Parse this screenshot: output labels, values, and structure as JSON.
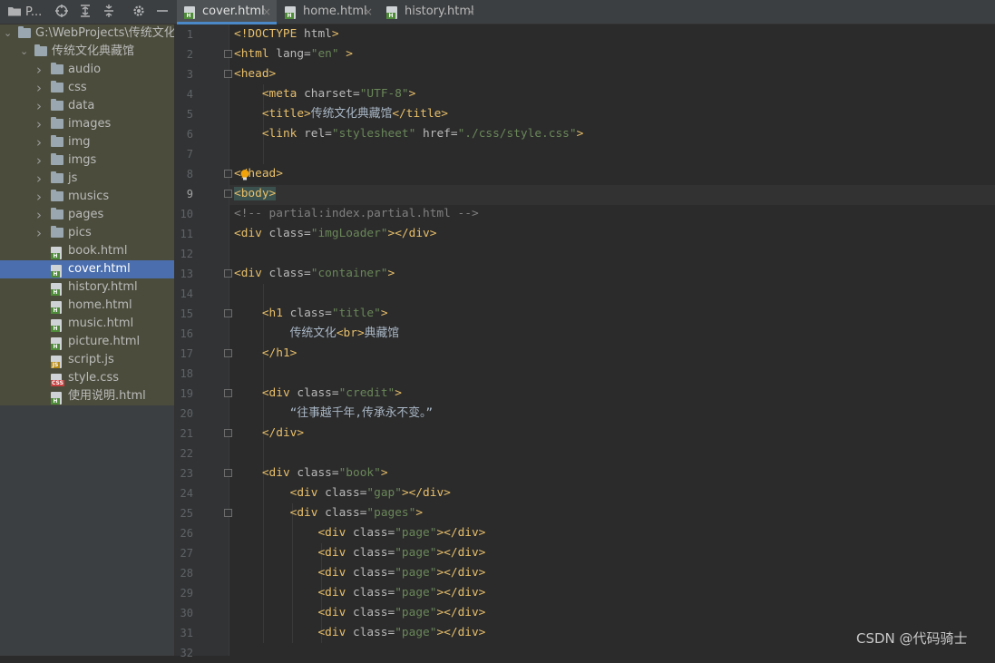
{
  "project_panel": {
    "title": "P...",
    "toolbar_icons": [
      "folder-icon",
      "locate-icon",
      "expand-all-icon",
      "collapse-all-icon",
      "gear-icon",
      "minimize-icon"
    ]
  },
  "tree": [
    {
      "label": "G:\\WebProjects\\传统文化典",
      "kind": "folder",
      "depth": 0,
      "expanded": true
    },
    {
      "label": "传统文化典藏馆",
      "kind": "folder",
      "depth": 1,
      "expanded": true
    },
    {
      "label": "audio",
      "kind": "folder",
      "depth": 2
    },
    {
      "label": "css",
      "kind": "folder",
      "depth": 2
    },
    {
      "label": "data",
      "kind": "folder",
      "depth": 2
    },
    {
      "label": "images",
      "kind": "folder",
      "depth": 2
    },
    {
      "label": "img",
      "kind": "folder",
      "depth": 2
    },
    {
      "label": "imgs",
      "kind": "folder",
      "depth": 2
    },
    {
      "label": "js",
      "kind": "folder",
      "depth": 2
    },
    {
      "label": "musics",
      "kind": "folder",
      "depth": 2
    },
    {
      "label": "pages",
      "kind": "folder",
      "depth": 2
    },
    {
      "label": "pics",
      "kind": "folder",
      "depth": 2
    },
    {
      "label": "book.html",
      "kind": "html",
      "depth": 2
    },
    {
      "label": "cover.html",
      "kind": "html",
      "depth": 2,
      "selected": true
    },
    {
      "label": "history.html",
      "kind": "html",
      "depth": 2
    },
    {
      "label": "home.html",
      "kind": "html",
      "depth": 2
    },
    {
      "label": "music.html",
      "kind": "html",
      "depth": 2
    },
    {
      "label": "picture.html",
      "kind": "html",
      "depth": 2
    },
    {
      "label": "script.js",
      "kind": "js",
      "depth": 2
    },
    {
      "label": "style.css",
      "kind": "css",
      "depth": 2
    },
    {
      "label": "使用说明.html",
      "kind": "html",
      "depth": 2
    }
  ],
  "tabs": [
    {
      "label": "cover.html",
      "active": true
    },
    {
      "label": "home.html",
      "active": false
    },
    {
      "label": "history.html",
      "active": false
    }
  ],
  "tab_close_glyph": "×",
  "badges": {
    "html": "H",
    "js": "JS",
    "css": "CSS"
  },
  "current_line": 9,
  "code_lines": [
    [
      {
        "t": "tag",
        "s": "<!DOCTYPE "
      },
      {
        "t": "attr",
        "s": "html"
      },
      {
        "t": "tag",
        "s": ">"
      }
    ],
    [
      {
        "t": "tag",
        "s": "<html "
      },
      {
        "t": "attr",
        "s": "lang="
      },
      {
        "t": "val",
        "s": "\"en\""
      },
      {
        "t": "tag",
        "s": " >"
      }
    ],
    [
      {
        "t": "tag",
        "s": "<head>"
      }
    ],
    [
      {
        "t": "txt",
        "s": "    "
      },
      {
        "t": "tag",
        "s": "<meta "
      },
      {
        "t": "attr",
        "s": "charset="
      },
      {
        "t": "val",
        "s": "\"UTF-8\""
      },
      {
        "t": "tag",
        "s": ">"
      }
    ],
    [
      {
        "t": "txt",
        "s": "    "
      },
      {
        "t": "tag",
        "s": "<title>"
      },
      {
        "t": "txt",
        "s": "传统文化典藏馆"
      },
      {
        "t": "tag",
        "s": "</title>"
      }
    ],
    [
      {
        "t": "txt",
        "s": "    "
      },
      {
        "t": "tag",
        "s": "<link "
      },
      {
        "t": "attr",
        "s": "rel="
      },
      {
        "t": "val",
        "s": "\"stylesheet\""
      },
      {
        "t": "attr",
        "s": " href="
      },
      {
        "t": "val",
        "s": "\"./css/style.css\""
      },
      {
        "t": "tag",
        "s": ">"
      }
    ],
    [],
    [
      {
        "t": "tag",
        "s": "</head>"
      }
    ],
    [
      {
        "t": "tagbox",
        "s": "<body>"
      }
    ],
    [
      {
        "t": "cmt",
        "s": "<!-- partial:index.partial.html -->"
      }
    ],
    [
      {
        "t": "tag",
        "s": "<div "
      },
      {
        "t": "attr",
        "s": "class="
      },
      {
        "t": "val",
        "s": "\"imgLoader\""
      },
      {
        "t": "tag",
        "s": "></div>"
      }
    ],
    [],
    [
      {
        "t": "tag",
        "s": "<div "
      },
      {
        "t": "attr",
        "s": "class="
      },
      {
        "t": "val",
        "s": "\"container\""
      },
      {
        "t": "tag",
        "s": ">"
      }
    ],
    [],
    [
      {
        "t": "txt",
        "s": "    "
      },
      {
        "t": "tag",
        "s": "<h1 "
      },
      {
        "t": "attr",
        "s": "class="
      },
      {
        "t": "val",
        "s": "\"title\""
      },
      {
        "t": "tag",
        "s": ">"
      }
    ],
    [
      {
        "t": "txt",
        "s": "        传统文化"
      },
      {
        "t": "tag",
        "s": "<br>"
      },
      {
        "t": "txt",
        "s": "典藏馆"
      }
    ],
    [
      {
        "t": "txt",
        "s": "    "
      },
      {
        "t": "tag",
        "s": "</h1>"
      }
    ],
    [],
    [
      {
        "t": "txt",
        "s": "    "
      },
      {
        "t": "tag",
        "s": "<div "
      },
      {
        "t": "attr",
        "s": "class="
      },
      {
        "t": "val",
        "s": "\"credit\""
      },
      {
        "t": "tag",
        "s": ">"
      }
    ],
    [
      {
        "t": "txt",
        "s": "        “往事越千年,传承永不变。”"
      }
    ],
    [
      {
        "t": "txt",
        "s": "    "
      },
      {
        "t": "tag",
        "s": "</div>"
      }
    ],
    [],
    [
      {
        "t": "txt",
        "s": "    "
      },
      {
        "t": "tag",
        "s": "<div "
      },
      {
        "t": "attr",
        "s": "class="
      },
      {
        "t": "val",
        "s": "\"book\""
      },
      {
        "t": "tag",
        "s": ">"
      }
    ],
    [
      {
        "t": "txt",
        "s": "        "
      },
      {
        "t": "tag",
        "s": "<div "
      },
      {
        "t": "attr",
        "s": "class="
      },
      {
        "t": "val",
        "s": "\"gap\""
      },
      {
        "t": "tag",
        "s": "></div>"
      }
    ],
    [
      {
        "t": "txt",
        "s": "        "
      },
      {
        "t": "tag",
        "s": "<div "
      },
      {
        "t": "attr",
        "s": "class="
      },
      {
        "t": "val",
        "s": "\"pages\""
      },
      {
        "t": "tag",
        "s": ">"
      }
    ],
    [
      {
        "t": "txt",
        "s": "            "
      },
      {
        "t": "tag",
        "s": "<div "
      },
      {
        "t": "attr",
        "s": "class="
      },
      {
        "t": "val",
        "s": "\"page\""
      },
      {
        "t": "tag",
        "s": "></div>"
      }
    ],
    [
      {
        "t": "txt",
        "s": "            "
      },
      {
        "t": "tag",
        "s": "<div "
      },
      {
        "t": "attr",
        "s": "class="
      },
      {
        "t": "val",
        "s": "\"page\""
      },
      {
        "t": "tag",
        "s": "></div>"
      }
    ],
    [
      {
        "t": "txt",
        "s": "            "
      },
      {
        "t": "tag",
        "s": "<div "
      },
      {
        "t": "attr",
        "s": "class="
      },
      {
        "t": "val",
        "s": "\"page\""
      },
      {
        "t": "tag",
        "s": "></div>"
      }
    ],
    [
      {
        "t": "txt",
        "s": "            "
      },
      {
        "t": "tag",
        "s": "<div "
      },
      {
        "t": "attr",
        "s": "class="
      },
      {
        "t": "val",
        "s": "\"page\""
      },
      {
        "t": "tag",
        "s": "></div>"
      }
    ],
    [
      {
        "t": "txt",
        "s": "            "
      },
      {
        "t": "tag",
        "s": "<div "
      },
      {
        "t": "attr",
        "s": "class="
      },
      {
        "t": "val",
        "s": "\"page\""
      },
      {
        "t": "tag",
        "s": "></div>"
      }
    ],
    [
      {
        "t": "txt",
        "s": "            "
      },
      {
        "t": "tag",
        "s": "<div "
      },
      {
        "t": "attr",
        "s": "class="
      },
      {
        "t": "val",
        "s": "\"page\""
      },
      {
        "t": "tag",
        "s": "></div>"
      }
    ],
    []
  ],
  "line_numbers": [
    "1",
    "2",
    "3",
    "4",
    "5",
    "6",
    "7",
    "8",
    "9",
    "10",
    "11",
    "12",
    "13",
    "14",
    "15",
    "16",
    "17",
    "18",
    "19",
    "20",
    "21",
    "22",
    "23",
    "24",
    "25",
    "26",
    "27",
    "28",
    "29",
    "30",
    "31",
    "32"
  ],
  "fold_lines": [
    2,
    3,
    8,
    9,
    13,
    15,
    17,
    19,
    21,
    23,
    25
  ],
  "watermark": "CSDN @代码骑士"
}
